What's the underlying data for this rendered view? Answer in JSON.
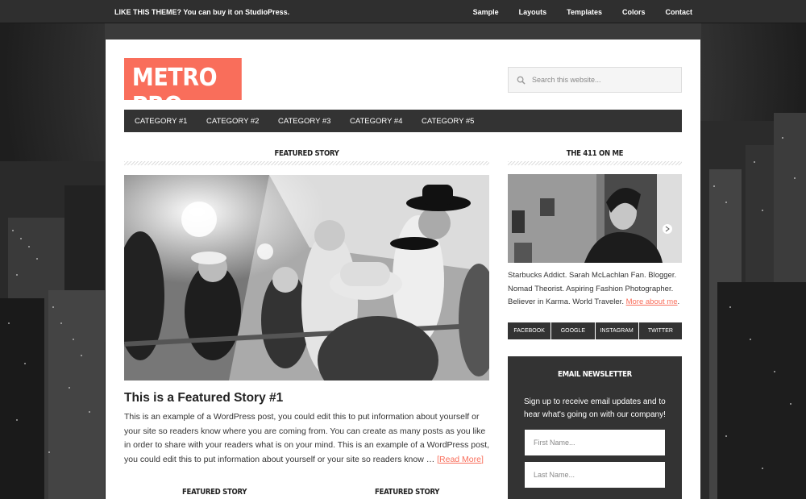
{
  "topbar": {
    "promo": "LIKE THIS THEME? You can buy it on StudioPress.",
    "nav": [
      "Sample",
      "Layouts",
      "Templates",
      "Colors",
      "Contact"
    ]
  },
  "header": {
    "logo": "METRO PRO",
    "search_placeholder": "Search this website...",
    "search_icon": "magnifier-icon"
  },
  "categories": [
    "CATEGORY #1",
    "CATEGORY #2",
    "CATEGORY #3",
    "CATEGORY #4",
    "CATEGORY #5"
  ],
  "main": {
    "section_title": "FEATURED STORY",
    "post_title": "This is a Featured Story #1",
    "post_excerpt": "This is an example of a WordPress post, you could edit this to put information about yourself or your site so readers know where you are coming from. You can create as many posts as you like in order to share with your readers what is on your mind. This is an example of a WordPress post, you could edit this to put information about yourself or your site so readers know … ",
    "read_more": "[Read More]",
    "sub_features": [
      "FEATURED STORY",
      "FEATURED STORY"
    ]
  },
  "sidebar": {
    "about_title": "THE 411 ON ME",
    "about_text": "Starbucks Addict. Sarah McLachlan Fan. Blogger. Nomad Theorist. Aspiring Fashion Photographer. Believer in Karma. World Traveler. ",
    "about_link": "More about me",
    "about_end": ".",
    "social": [
      "FACEBOOK",
      "GOOGLE",
      "INSTAGRAM",
      "TWITTER"
    ],
    "newsletter": {
      "title": "EMAIL NEWSLETTER",
      "text": "Sign up to receive email updates and to hear what's going on with our company!",
      "first_placeholder": "First Name...",
      "last_placeholder": "Last Name..."
    }
  },
  "colors": {
    "accent": "#f96e5b",
    "dark": "#333333"
  }
}
